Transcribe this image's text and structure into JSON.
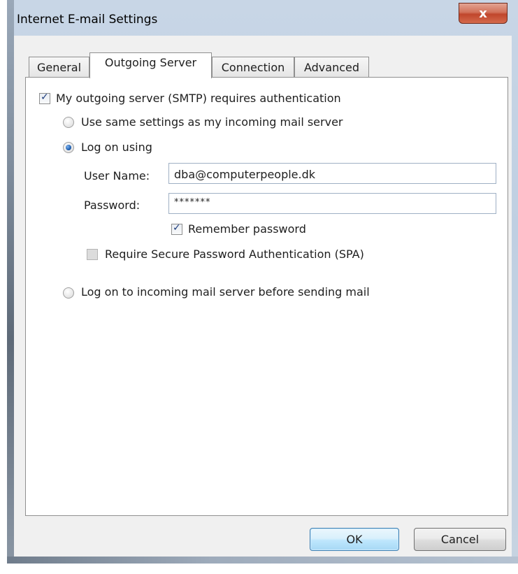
{
  "window": {
    "title": "Internet E-mail Settings",
    "close_glyph": "x"
  },
  "tabs": [
    {
      "label": "General",
      "active": false
    },
    {
      "label": "Outgoing Server",
      "active": true
    },
    {
      "label": "Connection",
      "active": false
    },
    {
      "label": "Advanced",
      "active": false
    }
  ],
  "auth": {
    "requires_auth_label": "My outgoing server (SMTP) requires authentication",
    "requires_auth_checked": true,
    "same_settings_label": "Use same settings as my incoming mail server",
    "logon_using_label": "Log on using",
    "username_label": "User Name:",
    "username_value": "dba@computerpeople.dk",
    "password_label": "Password:",
    "password_value": "*******",
    "remember_label": "Remember password",
    "remember_checked": true,
    "spa_label": "Require Secure Password Authentication (SPA)",
    "spa_checked": false,
    "logon_incoming_label": "Log on to incoming mail server before sending mail",
    "selected_option": "Log on using"
  },
  "buttons": {
    "ok": "OK",
    "cancel": "Cancel"
  },
  "colors": {
    "accent": "#1f5fb0",
    "ok_border": "#3c7fb1",
    "close_red": "#c0462c"
  }
}
